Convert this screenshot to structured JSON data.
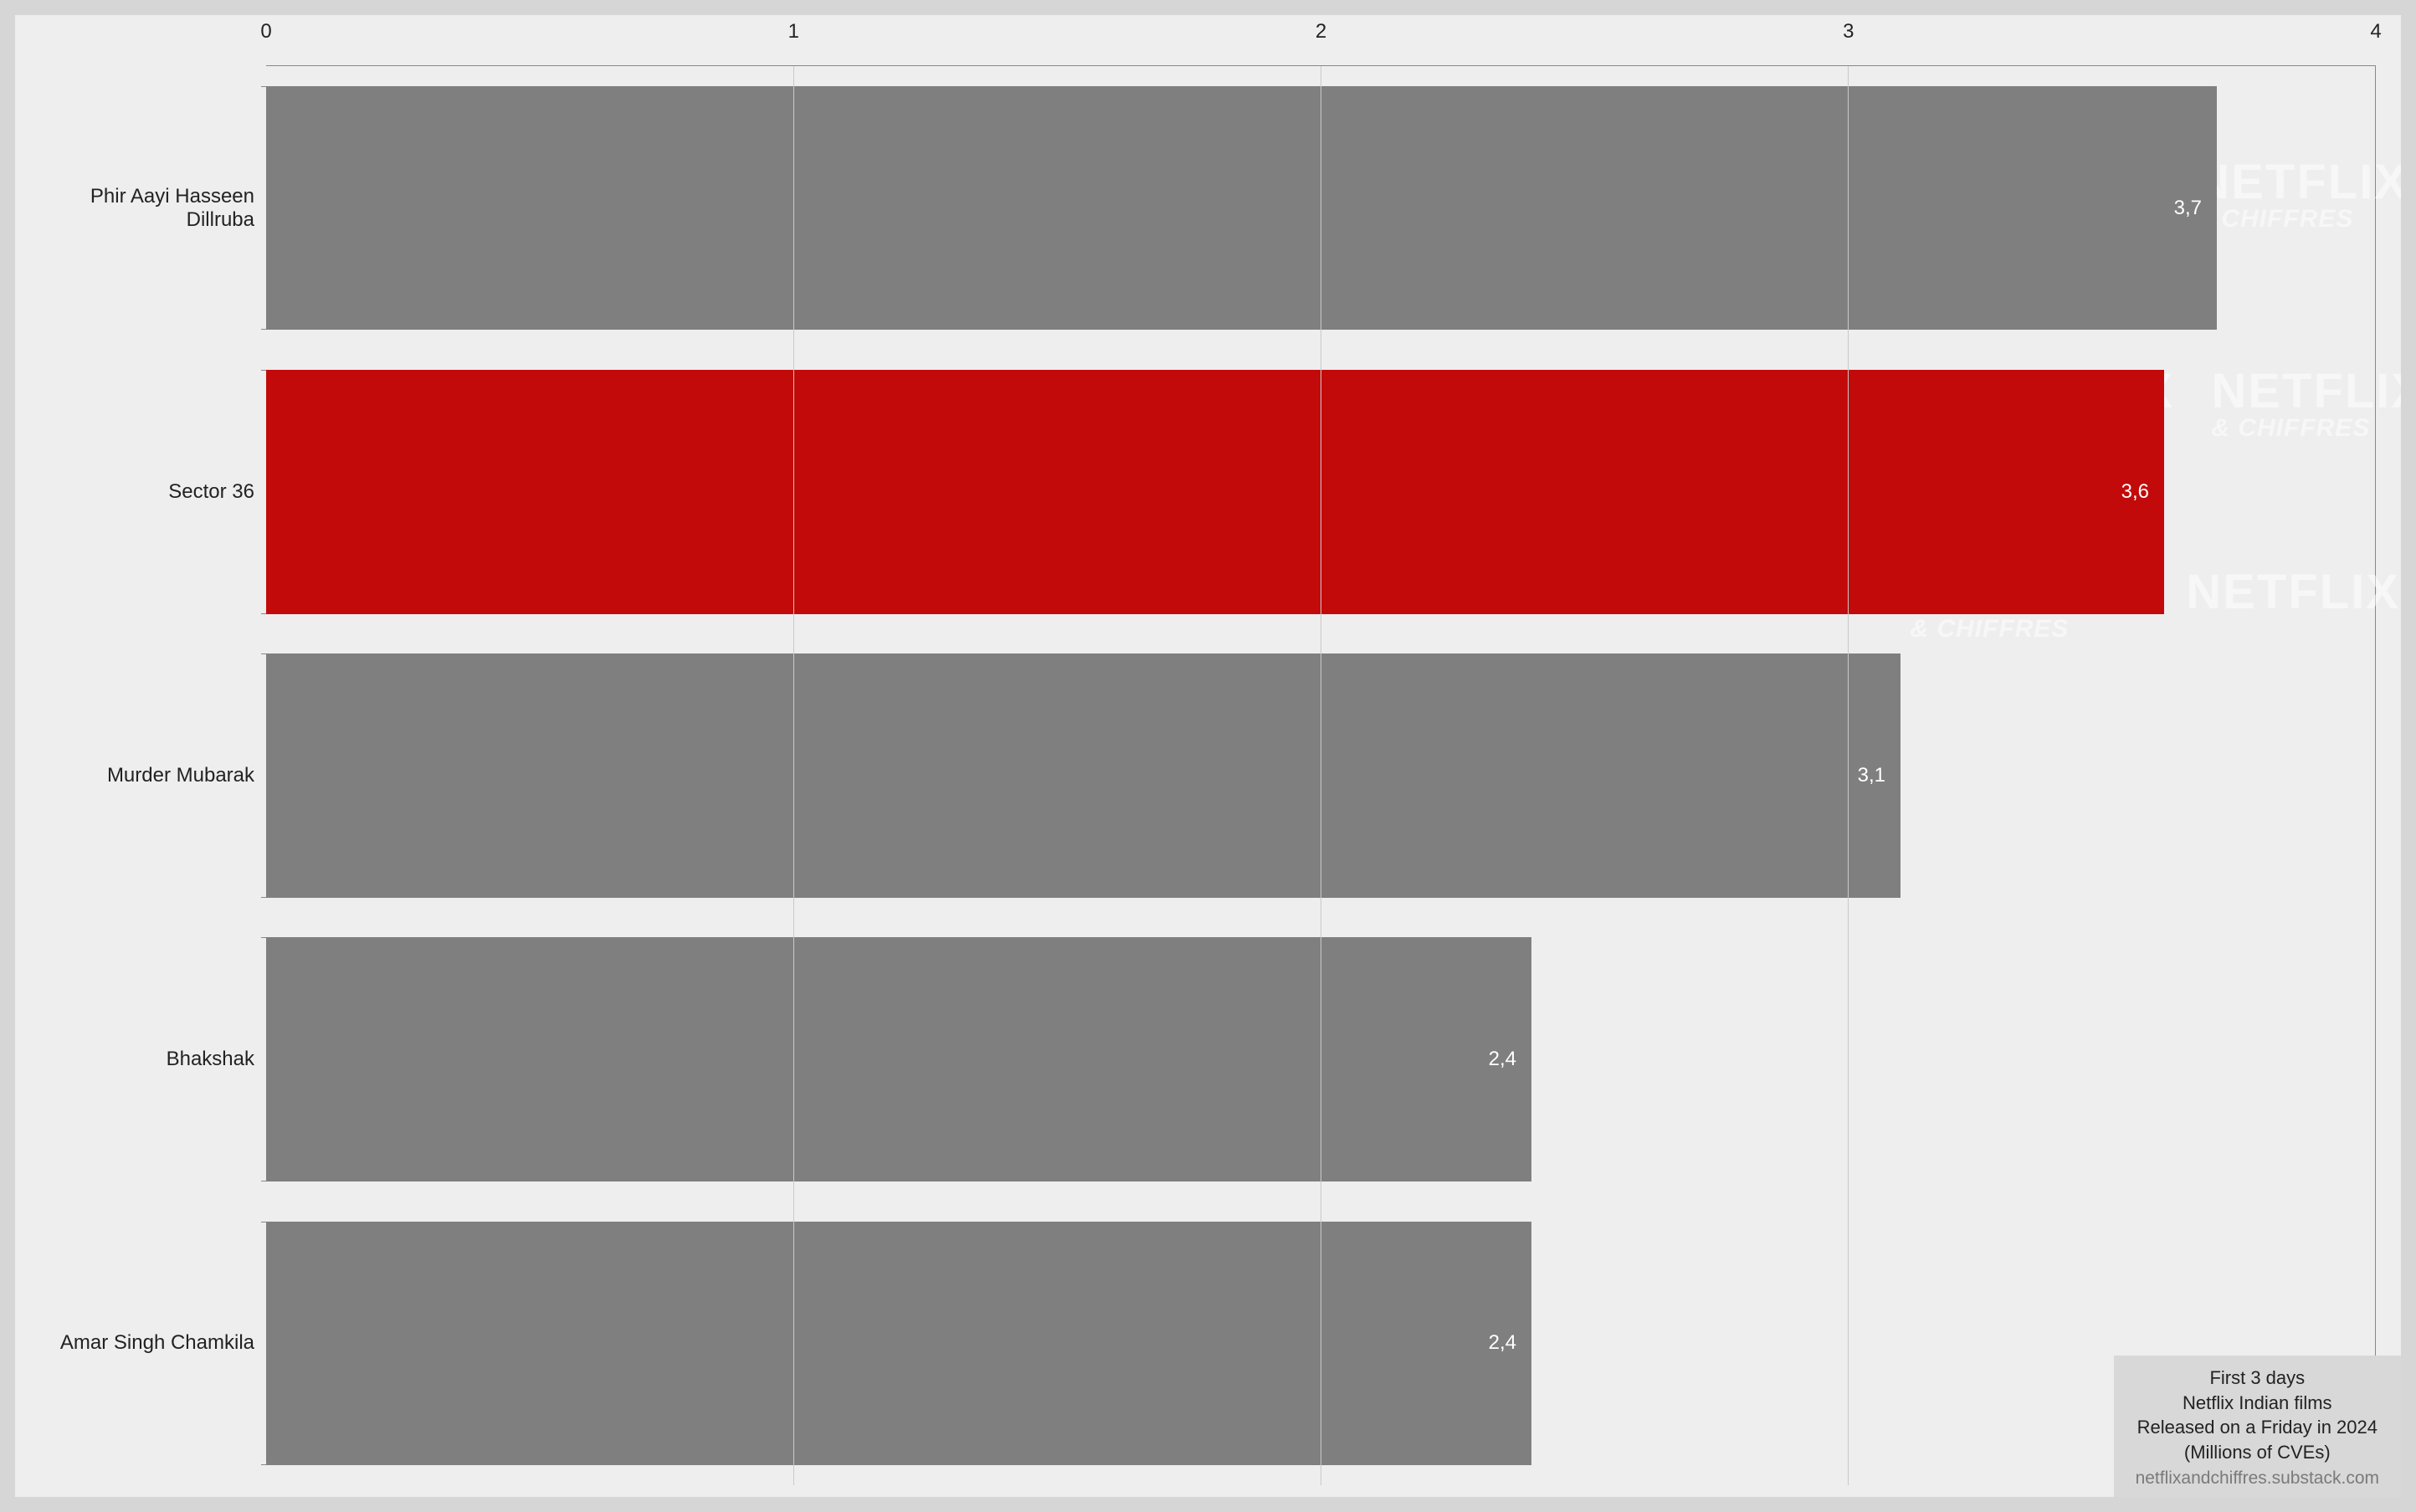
{
  "chart_data": {
    "type": "bar",
    "orientation": "horizontal",
    "categories": [
      "Phir Aayi Hasseen Dillruba",
      "Sector 36",
      "Murder Mubarak",
      "Bhakshak",
      "Amar Singh Chamkila"
    ],
    "values": [
      3.7,
      3.6,
      3.1,
      2.4,
      2.4
    ],
    "value_labels": [
      "3,7",
      "3,6",
      "3,1",
      "2,4",
      "2,4"
    ],
    "highlight_index": 1,
    "xlim": [
      0,
      4
    ],
    "xticks": [
      0,
      1,
      2,
      3,
      4
    ],
    "xtick_labels": [
      "0",
      "1",
      "2",
      "3",
      "4"
    ],
    "colors": {
      "default": "#7f7f7f",
      "highlight": "#c20a0a"
    },
    "caption": {
      "line1": "First 3 days",
      "line2": "Netflix Indian films",
      "line3": "Released on a Friday in 2024",
      "line4": "(Millions of CVEs)",
      "credit": "netflixandchiffres.substack.com"
    },
    "watermark": {
      "main": "NETFLIX",
      "sub": "& CHIFFRES"
    }
  }
}
